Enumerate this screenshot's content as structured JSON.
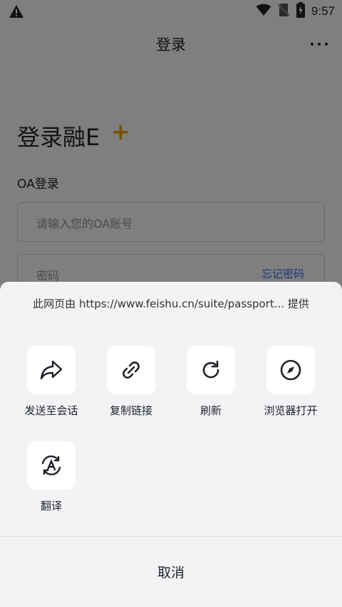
{
  "status_bar": {
    "time": "9:57",
    "icons": [
      "warning-icon",
      "wifi-icon",
      "no-sim-icon",
      "battery-charging-icon"
    ]
  },
  "nav": {
    "title": "登录",
    "more_icon": "more-horizontal-icon"
  },
  "login": {
    "heading": "登录融E",
    "heading_plus": "+",
    "section_label": "OA登录",
    "account_placeholder": "请输入您的OA账号",
    "password_placeholder": "密码",
    "forgot_password": "忘记密码"
  },
  "sheet": {
    "provider_text": "此网页由 https://www.feishu.cn/suite/passport... 提供",
    "actions": [
      {
        "label": "发送至会话",
        "icon": "share-forward-icon"
      },
      {
        "label": "复制链接",
        "icon": "link-icon"
      },
      {
        "label": "刷新",
        "icon": "refresh-icon"
      },
      {
        "label": "浏览器打开",
        "icon": "compass-icon"
      },
      {
        "label": "翻译",
        "icon": "translate-icon"
      }
    ],
    "cancel_label": "取消"
  },
  "colors": {
    "accent_plus": "#f2a100",
    "link_blue": "#3370ff",
    "sheet_bg": "#f2f3f5",
    "overlay": "rgba(0,0,0,0.5)"
  }
}
